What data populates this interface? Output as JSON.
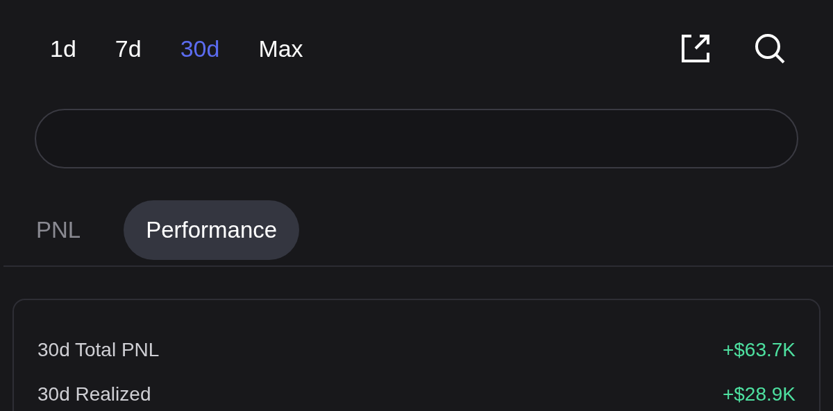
{
  "periods": [
    {
      "label": "1d",
      "selected": false
    },
    {
      "label": "7d",
      "selected": false
    },
    {
      "label": "30d",
      "selected": true
    },
    {
      "label": "Max",
      "selected": false
    }
  ],
  "view_tabs": [
    {
      "label": "PNL",
      "selected": false
    },
    {
      "label": "Performance",
      "selected": true
    }
  ],
  "stats": [
    {
      "label": "30d Total PNL",
      "value": "+$63.7K"
    },
    {
      "label": "30d Realized",
      "value": "+$28.9K"
    }
  ]
}
